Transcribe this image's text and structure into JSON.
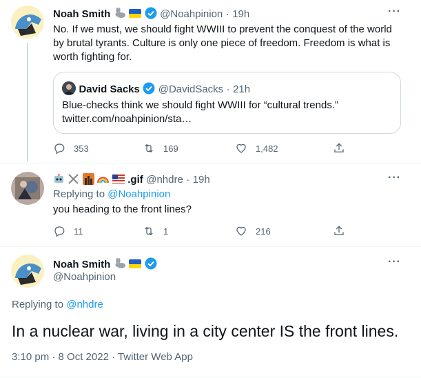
{
  "tweet1": {
    "name": "Noah Smith",
    "handle": "@Noahpinion",
    "time": "19h",
    "text_line1": "No. If we must, we should fight WWIII to prevent the conquest of the world",
    "text_line2": "by brutal tyrants. Culture is only one piece of freedom. Freedom is what is",
    "text_line3": "worth fighting for.",
    "quote": {
      "name": "David Sacks",
      "handle": "@DavidSacks",
      "time": "21h",
      "text_line1": "Blue-checks think we should fight WWIII for “cultural trends.”",
      "text_line2": "twitter.com/noahpinion/sta…"
    },
    "replies": "353",
    "retweets": "169",
    "likes": "1,482"
  },
  "tweet2": {
    "name_suffix": ".gif",
    "handle": "@nhdre",
    "time": "19h",
    "replying_prefix": "Replying to",
    "replying_to": "@Noahpinion",
    "text": "you heading to the front lines?",
    "replies": "11",
    "retweets": "1",
    "likes": "216"
  },
  "tweet3": {
    "name": "Noah Smith",
    "handle": "@Noahpinion",
    "replying_prefix": "Replying to",
    "replying_to": "@nhdre",
    "text": "In a nuclear war, living in a city center IS the front lines.",
    "timestamp": "3:10 pm · 8 Oct 2022 · Twitter Web App"
  },
  "icons": {
    "more": "more-horizontal-icon",
    "reply": "reply-icon",
    "retweet": "retweet-icon",
    "like": "heart-icon",
    "share": "share-icon",
    "verified": "verified-badge-icon",
    "flag": "ukraine-flag-icon",
    "rabbit": "rabbit-emoji-icon"
  },
  "colors": {
    "accent": "#1d9bf0",
    "text": "#0f1419",
    "muted": "#536471",
    "border": "#cfd9de"
  }
}
